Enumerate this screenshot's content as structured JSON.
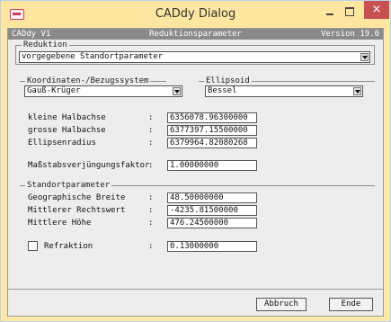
{
  "window": {
    "title": "CADdy Dialog",
    "close_glyph": "×"
  },
  "header": {
    "left": "CADdy V1",
    "center": "Reduktionsparameter",
    "right": "Version 19.0"
  },
  "reduktion": {
    "legend": "Reduktion",
    "selected": "vorgegebene Standortparameter"
  },
  "koordinaten": {
    "legend": "Koordinaten-/Bezugssystem",
    "selected": "Gauß-Krüger"
  },
  "ellipsoid": {
    "legend": "Ellipsoid",
    "selected": "Bessel",
    "fields": [
      {
        "label": "kleine Halbachse",
        "value": "6356078.96300000"
      },
      {
        "label": "grosse Halbachse",
        "value": "6377397.15500000"
      },
      {
        "label": "Ellipsenradius",
        "value": "6379964.82080268"
      }
    ]
  },
  "massstab": {
    "label": "Maßstabsverjüngungsfaktor",
    "value": "1.00000000"
  },
  "standort": {
    "legend": "Standortparameter",
    "fields": [
      {
        "label": "Geographische Breite",
        "value": "48.50000000"
      },
      {
        "label": "Mittlerer Rechtswert",
        "value": "-4235.81500000"
      },
      {
        "label": "Mittlere Höhe",
        "value": "476.24500000"
      }
    ]
  },
  "refraktion": {
    "label": "Refraktion",
    "value": "0.13000000",
    "checked": false
  },
  "colon": ":",
  "buttons": {
    "cancel": "Abbruch",
    "ok": "Ende"
  },
  "icons": {
    "dropdown": "chevron-down-icon",
    "app": "app-icon"
  }
}
